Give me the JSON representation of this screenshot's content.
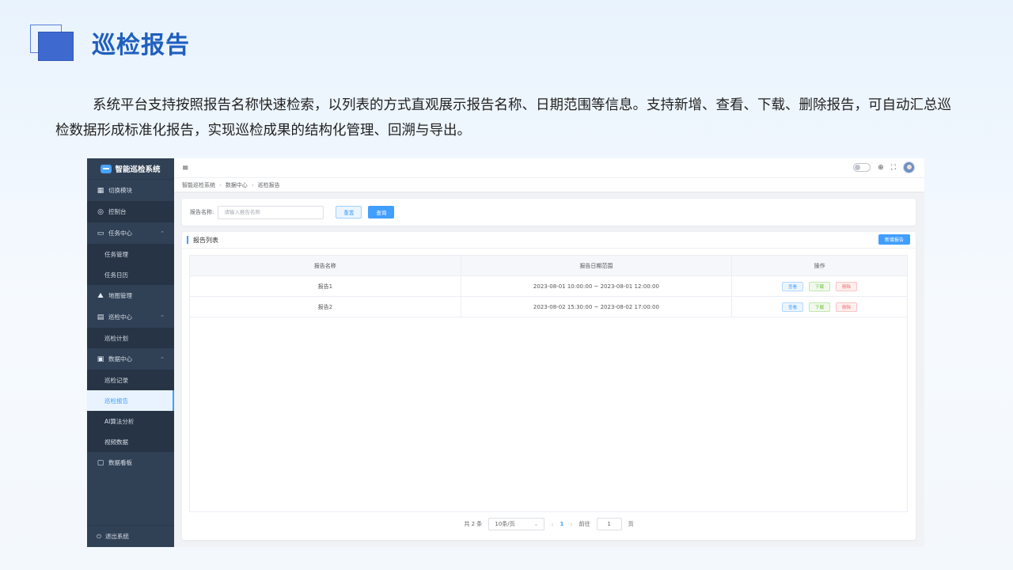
{
  "slide": {
    "title": "巡检报告",
    "description": "系统平台支持按照报告名称快速检索，以列表的方式直观展示报告名称、日期范围等信息。支持新增、查看、下载、删除报告，可自动汇总巡检数据形成标准化报告，实现巡检成果的结构化管理、回溯与导出。"
  },
  "app": {
    "name": "智能巡检系统",
    "sidebar": {
      "switch_module": "切换模块",
      "console": "控制台",
      "task_center": "任务中心",
      "task_manage": "任务管理",
      "task_calendar": "任务日历",
      "map_manage": "地图管理",
      "inspect_center": "巡检中心",
      "inspect_plan": "巡检计划",
      "data_center": "数据中心",
      "inspect_record": "巡检记录",
      "inspect_report": "巡检报告",
      "ai_analysis": "AI算法分析",
      "video_data": "视频数据",
      "dashboard": "数据看板",
      "logout": "退出系统"
    },
    "breadcrumb": [
      "智能巡检系统",
      "数据中心",
      "巡检报告"
    ],
    "search": {
      "label": "报告名称:",
      "placeholder": "请输入报告名称",
      "reset": "重置",
      "query": "查询"
    },
    "list": {
      "title": "报告列表",
      "add_button": "新增报告",
      "columns": [
        "报告名称",
        "报告日期范围",
        "操作"
      ],
      "rows": [
        {
          "name": "报告1",
          "range": "2023-08-01 10:00:00 ~ 2023-08-01 12:00:00"
        },
        {
          "name": "报告2",
          "range": "2023-08-02 15:30:00 ~ 2023-08-02 17:00:00"
        }
      ],
      "actions": {
        "view": "查看",
        "download": "下载",
        "delete": "删除"
      }
    },
    "pagination": {
      "total": "共 2 条",
      "page_size": "10条/页",
      "current_page": "1",
      "goto_label": "前往",
      "goto_value": "1",
      "page_unit": "页"
    }
  }
}
